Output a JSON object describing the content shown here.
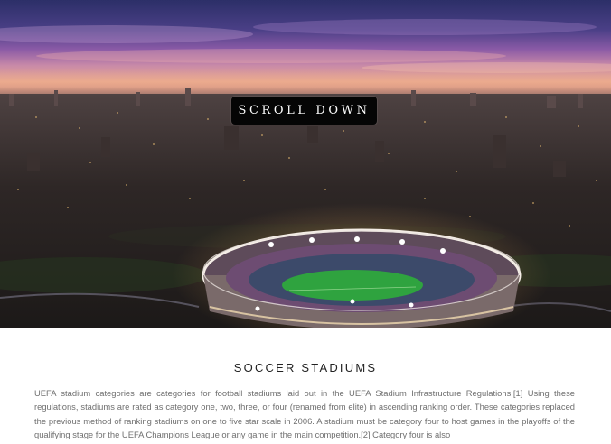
{
  "hero": {
    "scroll_button_label": "SCROLL DOWN"
  },
  "section": {
    "title": "SOCCER STADIUMS",
    "body": "UEFA stadium categories are categories for football stadiums laid out in the UEFA Stadium Infrastructure Regulations.[1] Using these regulations, stadiums are rated as category one, two, three, or four (renamed from elite) in ascending ranking order. These categories replaced the previous method of ranking stadiums on one to five star scale in 2006. A stadium must be category four to host games in the playoffs of the qualifying stage for the UEFA Champions League or any game in the main competition.[2] Category four is also"
  }
}
